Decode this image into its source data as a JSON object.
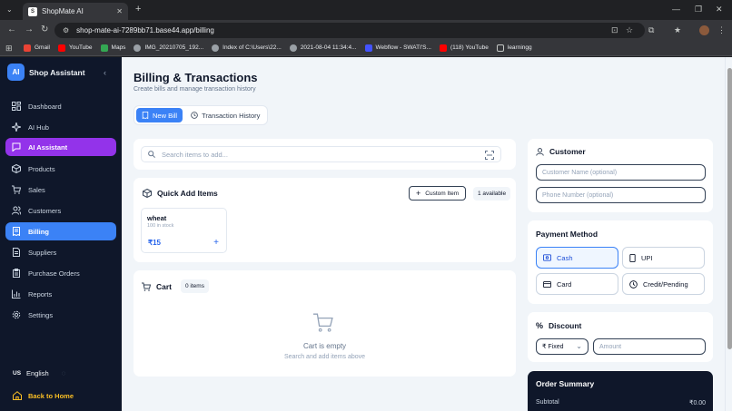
{
  "browser": {
    "tab_title": "ShopMate AI",
    "url": "shop-mate-ai-7289bb71.base44.app/billing",
    "bookmarks": [
      {
        "label": "Gmail",
        "color": "#ea4335"
      },
      {
        "label": "YouTube",
        "color": "#ff0000"
      },
      {
        "label": "Maps",
        "color": "#34a853"
      },
      {
        "label": "IMG_20210705_192...",
        "color": "#9aa0a6"
      },
      {
        "label": "Index of C:\\Users\\22...",
        "color": "#9aa0a6"
      },
      {
        "label": "2021-08-04 11:34:4...",
        "color": "#9aa0a6"
      },
      {
        "label": "Webflow - SWATI'S...",
        "color": "#4353ff"
      },
      {
        "label": "(118) YouTube",
        "color": "#ff0000"
      },
      {
        "label": "learningg",
        "color": "#9aa0a6"
      }
    ]
  },
  "sidebar": {
    "logo_text": "AI",
    "brand": "Shop Assistant",
    "items": [
      {
        "label": "Dashboard"
      },
      {
        "label": "AI Hub"
      },
      {
        "label": "AI Assistant"
      },
      {
        "label": "Products"
      },
      {
        "label": "Sales"
      },
      {
        "label": "Customers"
      },
      {
        "label": "Billing"
      },
      {
        "label": "Suppliers"
      },
      {
        "label": "Purchase Orders"
      },
      {
        "label": "Reports"
      },
      {
        "label": "Settings"
      }
    ],
    "language_code": "US",
    "language": "English",
    "back_home": "Back to Home"
  },
  "page": {
    "title": "Billing & Transactions",
    "subtitle": "Create bills and manage transaction history",
    "tabs": [
      "New Bill",
      "Transaction History"
    ]
  },
  "search": {
    "placeholder": "Search items to add..."
  },
  "quick_add": {
    "title": "Quick Add Items",
    "custom_button": "Custom Item",
    "available": "1 available",
    "products": [
      {
        "name": "wheat",
        "stock": "100 in stock",
        "price": "₹15"
      }
    ]
  },
  "cart": {
    "title": "Cart",
    "count": "0 items",
    "empty_title": "Cart is empty",
    "empty_sub": "Search and add items above"
  },
  "customer": {
    "title": "Customer",
    "name_placeholder": "Customer Name (optional)",
    "phone_placeholder": "Phone Number (optional)"
  },
  "payment": {
    "title": "Payment Method",
    "options": [
      "Cash",
      "UPI",
      "Card",
      "Credit/Pending"
    ],
    "selected": "Cash"
  },
  "discount": {
    "title": "Discount",
    "type": "₹ Fixed",
    "amount_placeholder": "Amount"
  },
  "summary": {
    "title": "Order Summary",
    "subtotal_label": "Subtotal",
    "subtotal_value": "₹0.00"
  },
  "colors": {
    "primary": "#3b82f6",
    "ai_purple": "#9333ea",
    "sidebar_bg": "#0f172a",
    "accent_gold": "#fbbf24"
  }
}
